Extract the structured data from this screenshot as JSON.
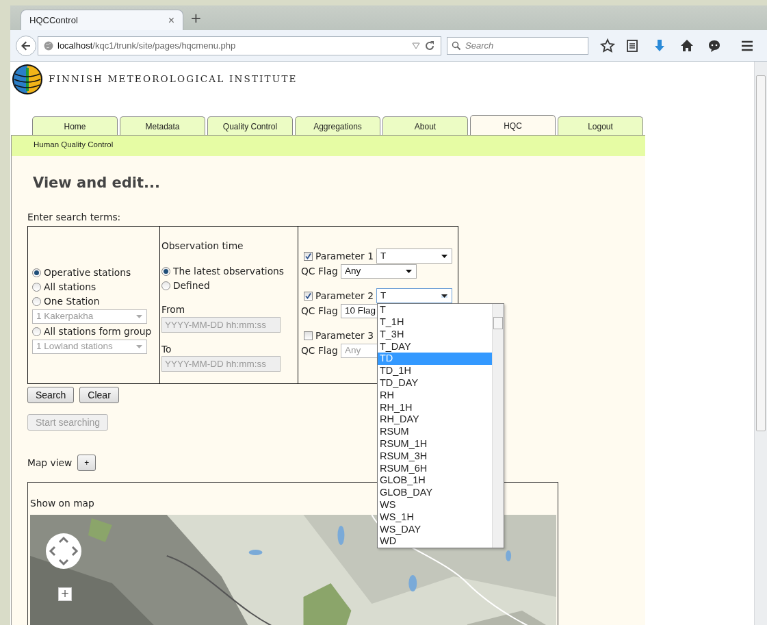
{
  "browser": {
    "tab_title": "HQCControl",
    "tab_close": "×",
    "new_tab": "+",
    "url_host": "localhost",
    "url_path": "/kqc1/trunk/site/pages/hqcmenu.php",
    "search_placeholder": "Search"
  },
  "logo_text": "FINNISH METEOROLOGICAL INSTITUTE",
  "nav_tabs": [
    {
      "label": "Home",
      "selected": false
    },
    {
      "label": "Metadata",
      "selected": false
    },
    {
      "label": "Quality Control",
      "selected": false
    },
    {
      "label": "Aggregations",
      "selected": false
    },
    {
      "label": "About",
      "selected": false
    },
    {
      "label": "HQC",
      "selected": true
    },
    {
      "label": "Logout",
      "selected": false
    }
  ],
  "sub_nav": "Human Quality Control",
  "heading": "View and edit...",
  "search_label": "Enter search terms:",
  "stations": [
    {
      "label": "Operative stations",
      "selected": true
    },
    {
      "label": "All stations",
      "selected": false
    },
    {
      "label": "One Station",
      "selected": false,
      "select": {
        "value": "1 Kakerpakha",
        "disabled": true
      }
    },
    {
      "label": "All stations form group",
      "selected": false,
      "select": {
        "value": "1 Lowland stations",
        "disabled": true
      }
    }
  ],
  "observation_time": {
    "title": "Observation time",
    "options": [
      {
        "label": "The latest observations",
        "selected": true
      },
      {
        "label": "Defined",
        "selected": false
      }
    ],
    "from_label": "From",
    "from_placeholder": "YYYY-MM-DD hh:mm:ss",
    "to_label": "To",
    "to_placeholder": "YYYY-MM-DD hh:mm:ss",
    "disabled": true
  },
  "parameters": [
    {
      "label": "Parameter 1",
      "checked": true,
      "value": "T",
      "expanded": false,
      "qc_label": "QC Flag",
      "qc_value": "Any",
      "disabled": false
    },
    {
      "label": "Parameter 2",
      "checked": true,
      "value": "T",
      "expanded": true,
      "qc_label": "QC Flag",
      "qc_value": "10 Flag",
      "disabled": false
    },
    {
      "label": "Parameter 3",
      "checked": false,
      "qc_label": "QC Flag",
      "qc_value": "Any",
      "disabled": true
    }
  ],
  "dropdown_options": [
    {
      "label": "T",
      "selected": false
    },
    {
      "label": "T_1H",
      "selected": false
    },
    {
      "label": "T_3H",
      "selected": false
    },
    {
      "label": "T_DAY",
      "selected": false
    },
    {
      "label": "TD",
      "selected": true
    },
    {
      "label": "TD_1H",
      "selected": false
    },
    {
      "label": "TD_DAY",
      "selected": false
    },
    {
      "label": "RH",
      "selected": false
    },
    {
      "label": "RH_1H",
      "selected": false
    },
    {
      "label": "RH_DAY",
      "selected": false
    },
    {
      "label": "RSUM",
      "selected": false
    },
    {
      "label": "RSUM_1H",
      "selected": false
    },
    {
      "label": "RSUM_3H",
      "selected": false
    },
    {
      "label": "RSUM_6H",
      "selected": false
    },
    {
      "label": "GLOB_1H",
      "selected": false
    },
    {
      "label": "GLOB_DAY",
      "selected": false
    },
    {
      "label": "WS",
      "selected": false
    },
    {
      "label": "WS_1H",
      "selected": false
    },
    {
      "label": "WS_DAY",
      "selected": false
    },
    {
      "label": "WD",
      "selected": false
    }
  ],
  "buttons": [
    {
      "label": "Search",
      "disabled": false
    },
    {
      "label": "Clear",
      "disabled": false
    }
  ],
  "start_button": {
    "label": "Start searching",
    "disabled": true
  },
  "map_view": {
    "label": "Map view",
    "toggle": "+"
  },
  "map": {
    "title": "Show on map",
    "zoom_in": "+",
    "kind": "picture"
  }
}
